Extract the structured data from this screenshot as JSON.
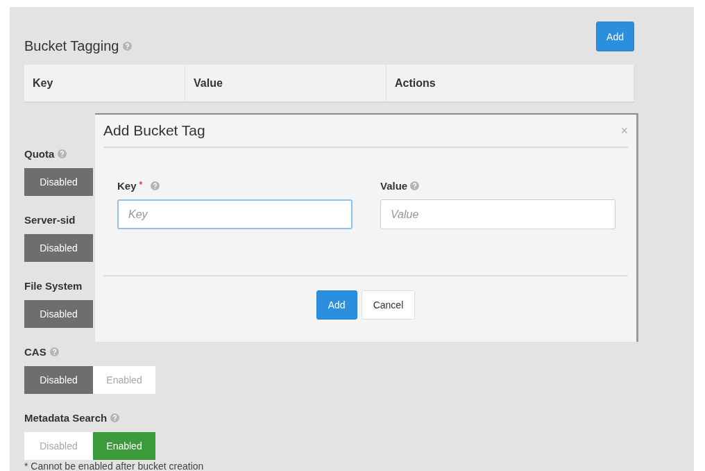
{
  "section": {
    "title": "Bucket Tagging",
    "help": true,
    "add_button": "Add",
    "table": {
      "columns": [
        "Key",
        "Value",
        "Actions"
      ]
    }
  },
  "settings": [
    {
      "label": "Quota",
      "help": true,
      "options": [
        {
          "label": "Disabled",
          "selected": true
        }
      ]
    },
    {
      "label": "Server-sid",
      "help": false,
      "options": [
        {
          "label": "Disabled",
          "selected": true
        }
      ]
    },
    {
      "label": "File System",
      "help": false,
      "options": [
        {
          "label": "Disabled",
          "selected": true
        }
      ]
    },
    {
      "label": "CAS",
      "help": true,
      "options": [
        {
          "label": "Disabled",
          "selected": true
        },
        {
          "label": "Enabled",
          "selected": false
        }
      ]
    },
    {
      "label": "Metadata Search",
      "help": true,
      "options": [
        {
          "label": "Disabled",
          "selected": false
        },
        {
          "label": "Enabled",
          "selected": true
        }
      ]
    }
  ],
  "footnote": "* Cannot be enabled after bucket creation",
  "modal": {
    "title": "Add Bucket Tag",
    "close": "×",
    "fields": [
      {
        "label": "Key",
        "required_mark": "*",
        "help": true,
        "placeholder": "Key",
        "focused": true
      },
      {
        "label": "Value",
        "help": true,
        "placeholder": "Value",
        "focused": false
      }
    ],
    "buttons": [
      {
        "label": "Add",
        "kind": "primary"
      },
      {
        "label": "Cancel",
        "kind": "default"
      }
    ]
  }
}
